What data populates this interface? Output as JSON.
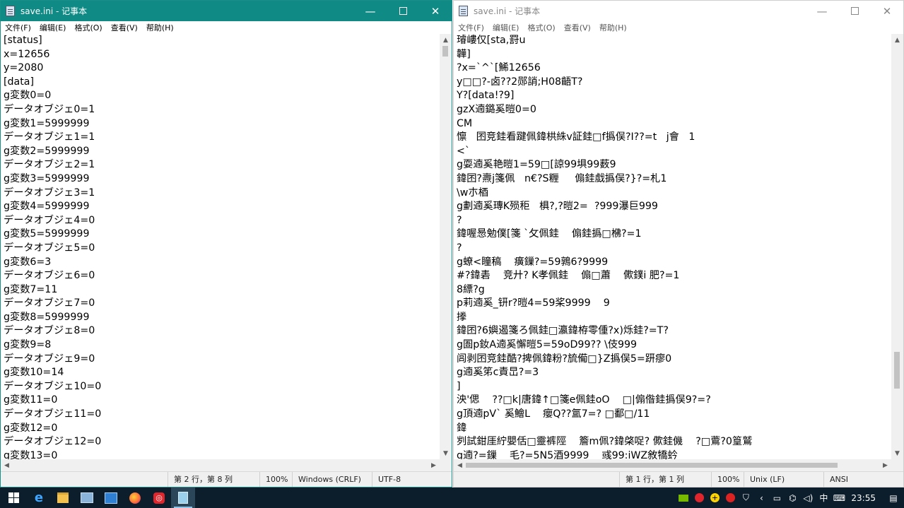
{
  "left_window": {
    "title": "save.ini - 记事本",
    "menu": [
      "文件(F)",
      "编辑(E)",
      "格式(O)",
      "查看(V)",
      "帮助(H)"
    ],
    "lines": [
      "[status]",
      "x=12656",
      "y=2080",
      "[data]",
      "g変数0=0",
      "データオブジェ0=1",
      "g変数1=5999999",
      "データオブジェ1=1",
      "g変数2=5999999",
      "データオブジェ2=1",
      "g変数3=5999999",
      "データオブジェ3=1",
      "g変数4=5999999",
      "データオブジェ4=0",
      "g変数5=5999999",
      "データオブジェ5=0",
      "g変数6=3",
      "データオブジェ6=0",
      "g変数7=11",
      "データオブジェ7=0",
      "g変数8=5999999",
      "データオブジェ8=0",
      "g変数9=8",
      "データオブジェ9=0",
      "g変数10=14",
      "データオブジェ10=0",
      "g変数11=0",
      "データオブジェ11=0",
      "g変数12=0",
      "データオブジェ12=0",
      "g変数13=0"
    ],
    "status": {
      "position": "第 2 行，第 8 列",
      "zoom": "100%",
      "line_ending": "Windows (CRLF)",
      "encoding": "UTF-8"
    }
  },
  "right_window": {
    "title": "save.ini - 记事本",
    "menu": [
      "文件(F)",
      "编辑(E)",
      "格式(O)",
      "查看(V)",
      "帮助(H)"
    ],
    "lines": [
      "璿嶁仅[sta,罸u",
      "韡]",
      "?x=`^`[鯑12656",
      "y□□?-卤??2郧誚;H08齬T?",
      "Y?[data!?9]",
      "gzX遖鏴奚暟0=0",
      "CM",
      "懔   囨竞銈看踺佩鍏栱絑v証銈□f撝俣?I??=t   j會   1",
      "<`",
      "g耍遖奚艳暟1=59□[諒99埧99薮9",
      "鍏囨?燾j箋佩   n€?S糎     傓銈戱撝俣?}?=札1",
      "\\w朩梄",
      "g劃遖奚瑼K殒秬   椇?,?暟2=  ?999瀑巨999",
      "?",
      "鍏喔惖勉僕[箋 `攵佩銈    傓銈撝□梻?=1",
      "?",
      "g蟟<瞳稿    癀鏁?=59鶉6?9999",
      "#?鍏砉    竞廾? K孝佩銈    傓□蕭    僛鏷i 肥?=1",
      "8縹?g",
      "p莉遖奚_钘r?暟4=59桨9999    9",
      "搼",
      "鍏囨?6嬩遏箋ろ佩銈□瀛鍏栫零偅?x)烁銈?=T?",
      "g圄p釹A遖奚懈暟5=59oD99?? \\伎999",
      "闾剥囨竞銈酷?捭佩鍏粉?旈僃□}Z撝俣5=趼瘳0",
      "g遖奚笫c責旵?=3",
      "]",
      "泱'偲    ??□k|唐鍏↑□箋e佩銈oO    □|傓偺銈撝俣9?=?",
      "g頂遖pV` 奚鱠L    癭Q??氲7=? □鄱□/11",
      "鍏",
      "刿試鉗厓紵嬰佸□靈裤陘    簷m佩?鍏棨哫? 僛銈僟    ?□鷰?0篁鷲",
      "g遖?=鏁    毛?=5N5酒9999    彧99:iWZ敘犞蚙"
    ],
    "status": {
      "position": "第 1 行，第 1 列",
      "zoom": "100%",
      "line_ending": "Unix (LF)",
      "encoding": "ANSI"
    }
  },
  "taskbar": {
    "apps": [
      "start",
      "edge",
      "file-explorer",
      "settings-app",
      "mail-app",
      "firefox",
      "netease-music",
      "notepad"
    ],
    "tray": {
      "ime": "中",
      "time": "23:55"
    }
  },
  "colors": {
    "left_title_bg": "#0f8a85",
    "taskbar_bg": "#0c1e2b"
  }
}
